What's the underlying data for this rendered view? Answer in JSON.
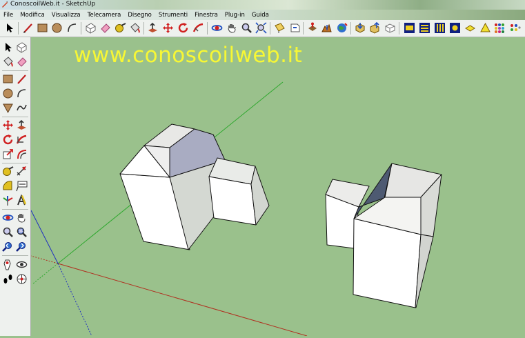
{
  "window": {
    "title": "ConoscoilWeb.it - SketchUp"
  },
  "menu": {
    "items": [
      "File",
      "Modifica",
      "Visualizza",
      "Telecamera",
      "Disegno",
      "Strumenti",
      "Finestra",
      "Plug-in",
      "Guida"
    ]
  },
  "viewport": {
    "watermark": "www.conoscoilweb.it",
    "background_color": "#9ac18c",
    "axis_colors": {
      "green": "#2fa82f",
      "red": "#b03020",
      "blue": "#2030c0"
    }
  },
  "toolbar": {
    "icons": [
      "select-icon",
      "line-icon",
      "rectangle-icon",
      "circle-icon",
      "arc-icon",
      "make-component-icon",
      "eraser-icon",
      "tape-measure-icon",
      "paint-bucket-icon",
      "push-pull-icon",
      "move-icon",
      "rotate-icon",
      "follow-me-icon",
      "orbit-icon",
      "pan-icon",
      "zoom-icon",
      "zoom-extents-icon",
      "section-plane-icon",
      "previous-view-icon",
      "add-location-icon",
      "toggle-terrain-icon",
      "google-earth-icon",
      "get-models-icon",
      "share-model-icon",
      "share-component-icon",
      "photo-textures-icon",
      "iso-view-icon",
      "top-view-icon",
      "front-view-icon",
      "right-view-icon",
      "shadow-icon",
      "fog-icon",
      "color-by-layer-icon"
    ]
  },
  "left_toolbar": {
    "icons": [
      "select-icon",
      "make-component-icon",
      "paint-bucket-icon",
      "eraser-icon",
      "rectangle-icon",
      "line-icon",
      "circle-icon",
      "arc-icon",
      "polygon-icon",
      "freehand-icon",
      "move-icon",
      "push-pull-icon",
      "rotate-icon",
      "follow-me-icon",
      "scale-icon",
      "offset-icon",
      "tape-measure-icon",
      "dimension-icon",
      "protractor-icon",
      "text-icon",
      "axes-icon",
      "3d-text-icon",
      "orbit-icon",
      "pan-icon",
      "zoom-icon",
      "zoom-window-icon",
      "previous-icon",
      "zoom-extents-icon",
      "position-camera-icon",
      "look-around-icon",
      "walk-icon",
      "section-plane-icon"
    ]
  }
}
